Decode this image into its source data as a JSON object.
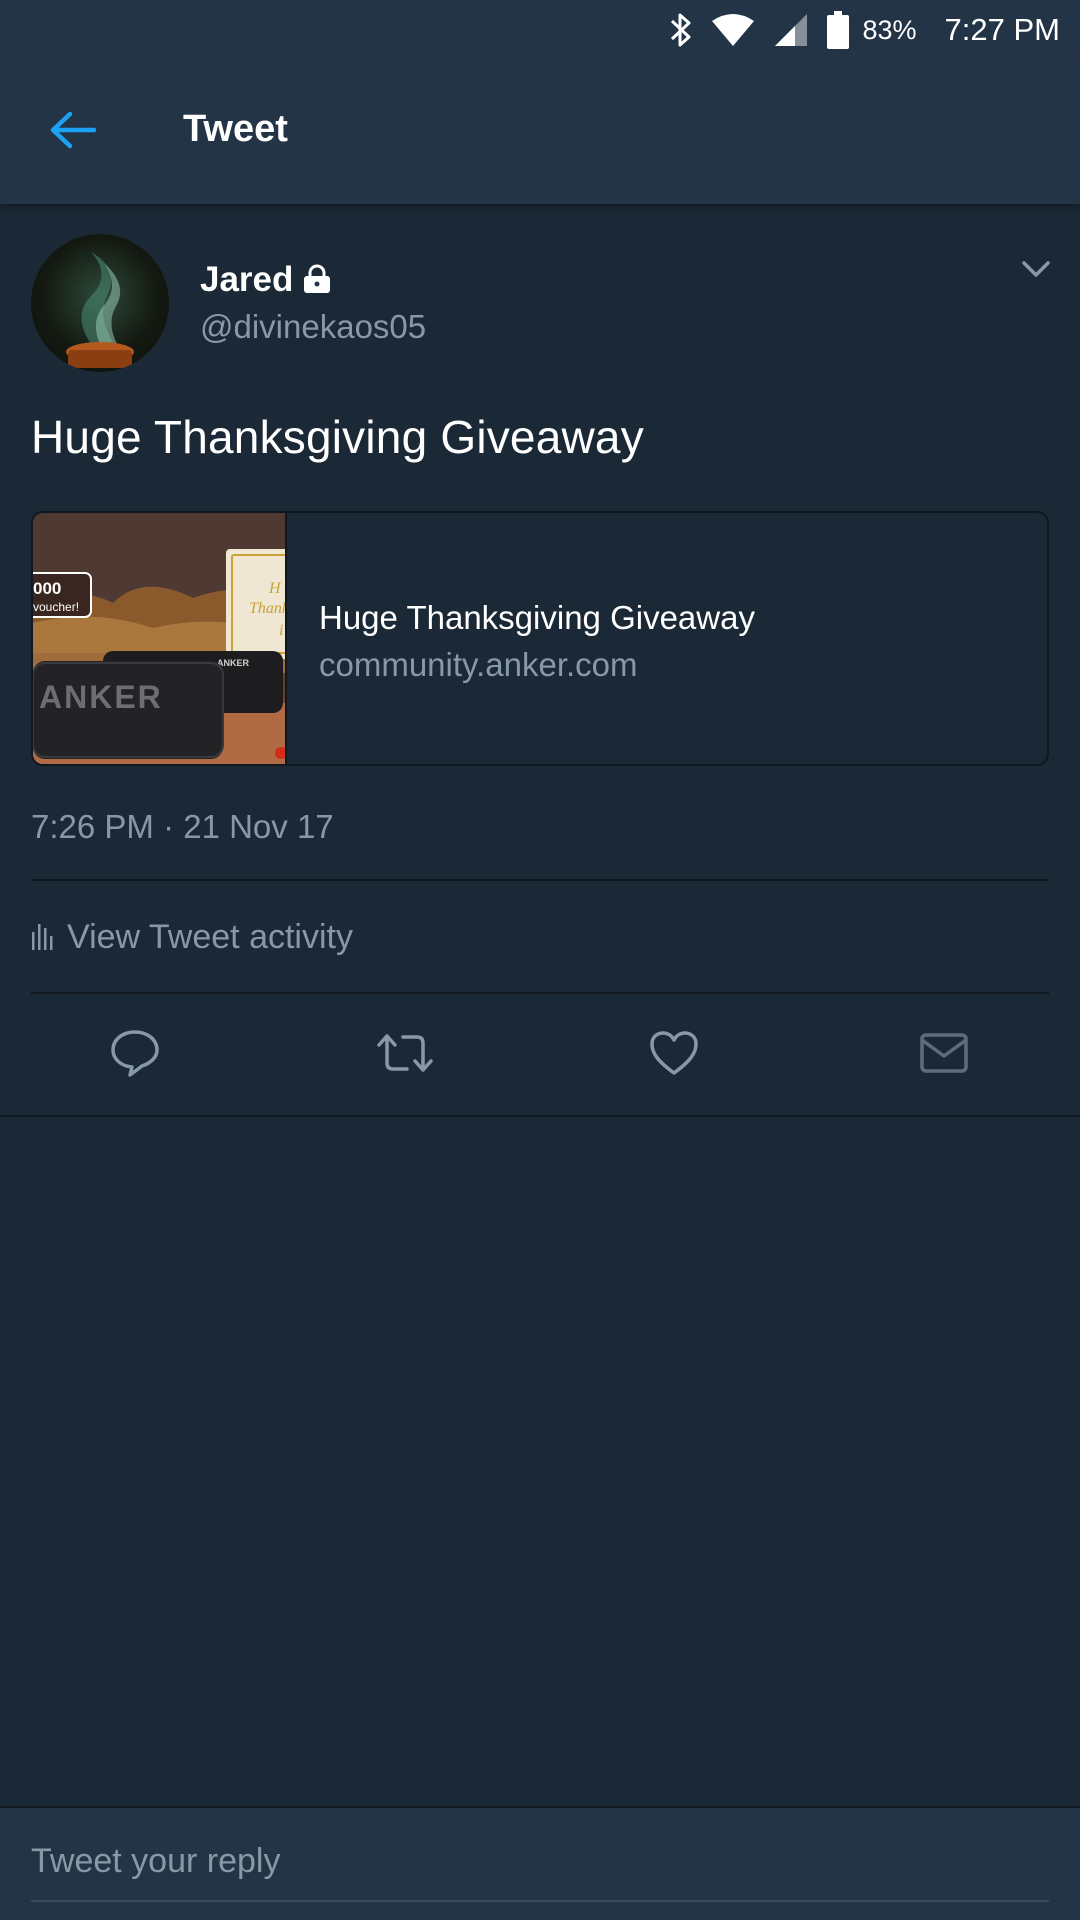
{
  "status_bar": {
    "battery_percent": "83%",
    "time": "7:27 PM",
    "icons": [
      "bluetooth-icon",
      "wifi-icon",
      "cell-signal-icon",
      "battery-icon"
    ]
  },
  "app_bar": {
    "title": "Tweet",
    "back_icon": "arrow-left-icon"
  },
  "tweet": {
    "author": {
      "name": "Jared",
      "handle": "@divinekaos05",
      "protected_icon": "lock-icon"
    },
    "text": "Huge Thanksgiving Giveaway",
    "card": {
      "title": "Huge Thanksgiving Giveaway",
      "domain": "community.anker.com",
      "thumbnail": {
        "voucher_amount": "000",
        "voucher_text": "voucher!",
        "speaker_brand": "ANKER",
        "small_brand": "ANKER",
        "card_text_1": "H",
        "card_text_2": "Thank",
        "card_text_3": "i"
      }
    },
    "timestamp": "7:26 PM · 21 Nov 17",
    "activity_label": "View Tweet activity"
  },
  "actions": [
    "reply-icon",
    "retweet-icon",
    "like-icon",
    "direct-message-icon"
  ],
  "reply": {
    "placeholder": "Tweet your reply"
  },
  "colors": {
    "background": "#1b2836",
    "bar": "#243447",
    "accent": "#1da1f2",
    "secondary_text": "#8899a6"
  }
}
